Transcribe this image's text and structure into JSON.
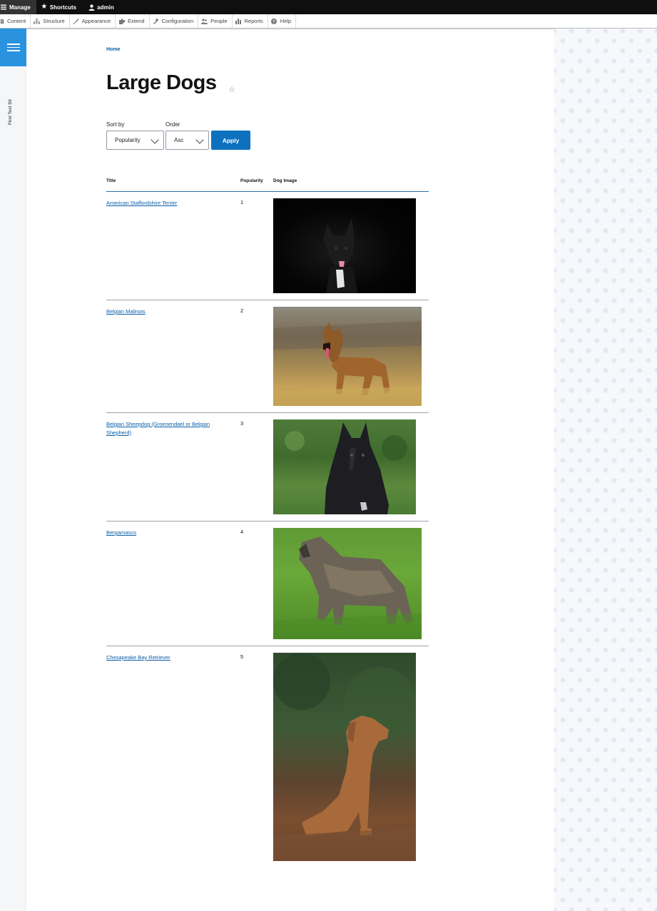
{
  "toolbar": {
    "manage": "Manage",
    "shortcuts": "Shortcuts",
    "user": "admin"
  },
  "tray": [
    {
      "label": "Content",
      "icon": "content-icon"
    },
    {
      "label": "Structure",
      "icon": "structure-icon"
    },
    {
      "label": "Appearance",
      "icon": "appearance-icon"
    },
    {
      "label": "Extend",
      "icon": "extend-icon"
    },
    {
      "label": "Configuration",
      "icon": "configuration-icon"
    },
    {
      "label": "People",
      "icon": "people-icon"
    },
    {
      "label": "Reports",
      "icon": "reports-icon"
    },
    {
      "label": "Help",
      "icon": "help-icon"
    }
  ],
  "sidebar": {
    "vertical_label": "First Test Sit"
  },
  "breadcrumb": "Home",
  "page": {
    "title": "Large Dogs"
  },
  "filters": {
    "sort_label": "Sort by",
    "sort_value": "Popularity",
    "order_label": "Order",
    "order_value": "Asc",
    "apply_label": "Apply"
  },
  "table": {
    "headers": {
      "title": "Title",
      "popularity": "Popularity",
      "image": "Dog Image"
    },
    "rows": [
      {
        "title": "American Staffordshire Terrier",
        "popularity": "1"
      },
      {
        "title": "Belgian Malinois",
        "popularity": "2"
      },
      {
        "title": "Belgian Sheepdog (Groenendael or Belgian Shepherd)",
        "popularity": "3"
      },
      {
        "title": "Bergamasco",
        "popularity": "4"
      },
      {
        "title": "Chesapeake Bay Retriever",
        "popularity": "5"
      }
    ]
  },
  "colors": {
    "toolbar_bg": "#0f0f0f",
    "accent": "#0e71bd",
    "link": "#0b5ea8",
    "sidebar_toggle": "#2a93e0"
  }
}
